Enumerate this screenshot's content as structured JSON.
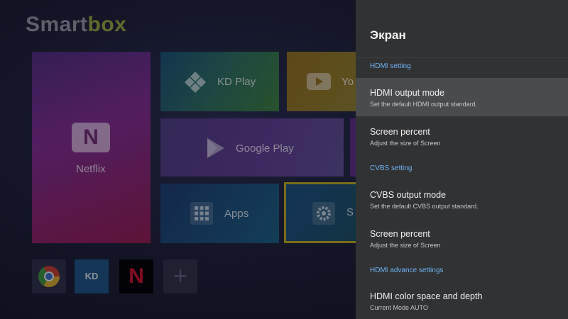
{
  "home": {
    "logo_part1": "Smart",
    "logo_part2": "box",
    "tiles": {
      "netflix": "Netflix",
      "kd_play": "KD Play",
      "youtube": "Yo",
      "google_play": "Google Play",
      "apps": "Apps",
      "settings": "S"
    },
    "netflix_icon_letter": "N",
    "kd_small_label": "KD",
    "netflix_small_letter": "N",
    "add_symbol": "+"
  },
  "panel": {
    "title": "Экран",
    "sections": [
      {
        "label": "HDMI setting"
      },
      {
        "label": "CVBS setting"
      },
      {
        "label": "HDMI advance settings"
      }
    ],
    "items": [
      {
        "title": "HDMI output mode",
        "subtitle": "Set the default HDMI output standard."
      },
      {
        "title": "Screen percent",
        "subtitle": "Adjust the size of Screen"
      },
      {
        "title": "CVBS output mode",
        "subtitle": "Set the default CVBS output standard."
      },
      {
        "title": "Screen percent",
        "subtitle": "Adjust the size of Screen"
      },
      {
        "title": "HDMI color space and depth",
        "subtitle": "Current Mode AUTO"
      }
    ]
  },
  "colors": {
    "panel_bg": "#313234",
    "focused_row": "#4a4b4e",
    "section_accent": "#6fb4f2",
    "settings_focus_border": "#b8a51a"
  }
}
